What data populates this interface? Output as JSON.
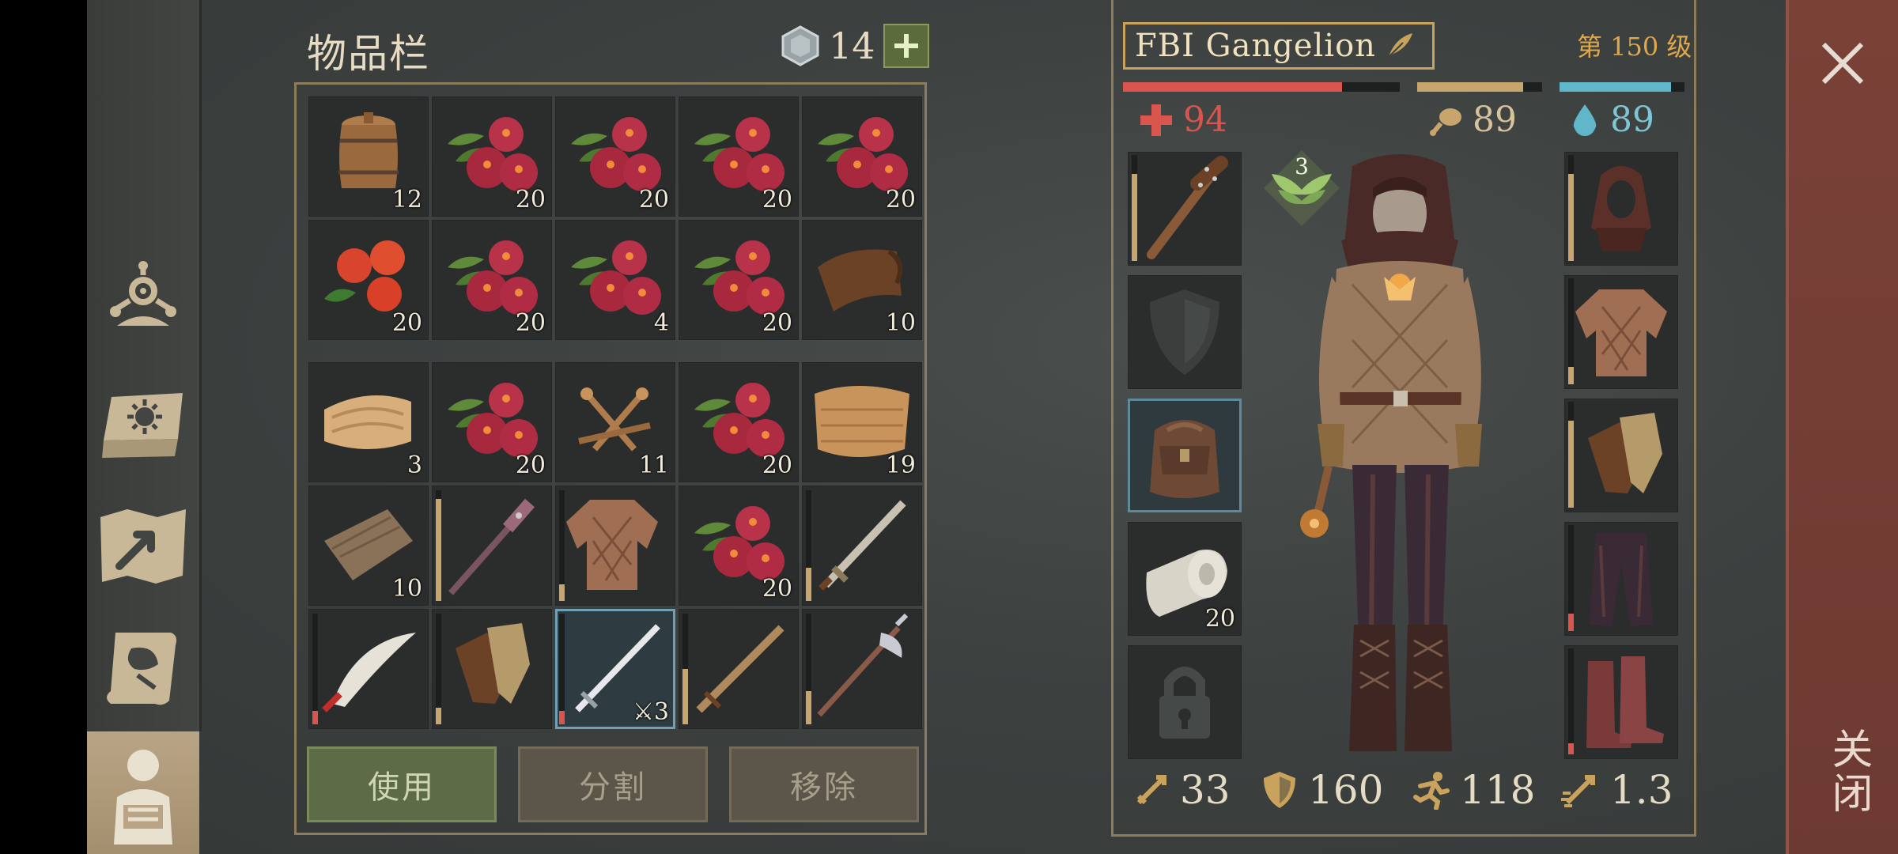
{
  "inventory": {
    "title": "物品栏",
    "coins": "14",
    "top_grid": [
      {
        "item": "barrel-icon",
        "qty": "12"
      },
      {
        "item": "berries-icon",
        "qty": "20"
      },
      {
        "item": "berries-icon",
        "qty": "20"
      },
      {
        "item": "berries-icon",
        "qty": "20"
      },
      {
        "item": "berries-icon",
        "qty": "20"
      },
      {
        "item": "oranges-icon",
        "qty": "20"
      },
      {
        "item": "berries-icon",
        "qty": "20"
      },
      {
        "item": "berries-icon",
        "qty": "4"
      },
      {
        "item": "berries-icon",
        "qty": "20"
      },
      {
        "item": "leather-scroll-icon",
        "qty": "10"
      }
    ],
    "bottom_grid": [
      {
        "item": "cloth-roll-icon",
        "qty": "3"
      },
      {
        "item": "berries-icon",
        "qty": "20"
      },
      {
        "item": "nails-icon",
        "qty": "11"
      },
      {
        "item": "berries-icon",
        "qty": "20"
      },
      {
        "item": "fiber-cloth-icon",
        "qty": "19"
      },
      {
        "item": "wood-plank-icon",
        "qty": "10"
      },
      {
        "item": "spiked-mace-icon",
        "qty": ""
      },
      {
        "item": "quilted-vest-icon",
        "qty": ""
      },
      {
        "item": "berries-icon",
        "qty": "20"
      },
      {
        "item": "short-sword-icon",
        "qty": ""
      },
      {
        "item": "scimitar-icon",
        "qty": ""
      },
      {
        "item": "leather-gloves-icon",
        "qty": ""
      },
      {
        "item": "steel-sword-icon",
        "qty": "3"
      },
      {
        "item": "wooden-sword-icon",
        "qty": ""
      },
      {
        "item": "halberd-icon",
        "qty": ""
      }
    ],
    "buttons": {
      "use": "使用",
      "split": "分割",
      "remove": "移除"
    }
  },
  "character": {
    "name": "FBI Gangelion",
    "level": "第 150 级",
    "health": "94",
    "food": "89",
    "water": "89",
    "health_fill": 0.79,
    "food_fill": 0.85,
    "water_fill": 0.89,
    "rank_badge": "3",
    "backpack_qty": "20",
    "stats": {
      "damage": "33",
      "armor": "160",
      "speed": "118",
      "attack_speed": "1.3"
    },
    "left_slots": [
      "spiked-club-icon",
      "shield-slot-icon",
      "backpack-icon",
      "bandage-icon",
      "locked-slot-icon"
    ],
    "right_slots": [
      "hood-icon",
      "quilted-jacket-icon",
      "leather-gloves-icon",
      "trousers-icon",
      "boots-icon"
    ]
  },
  "close_label": "关闭",
  "colors": {
    "health": "#d9554e",
    "food": "#c8a56c",
    "water": "#5fb7c9",
    "accent": "#c9a25b"
  }
}
